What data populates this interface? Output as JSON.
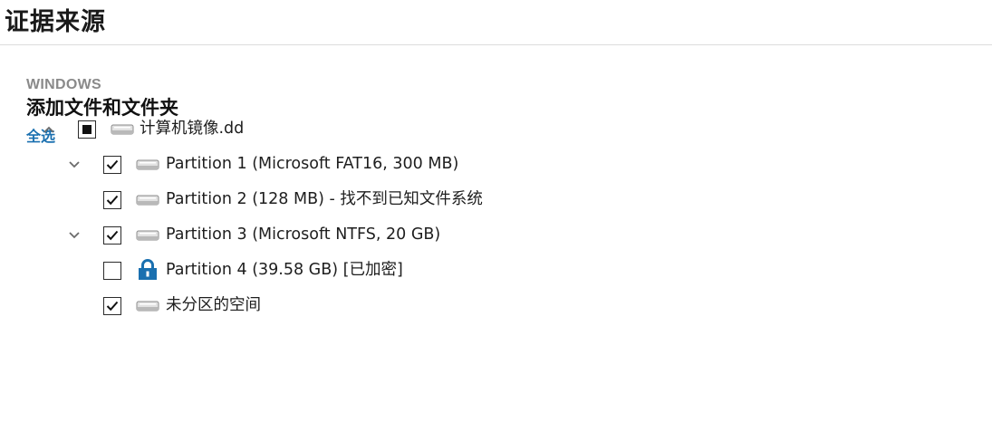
{
  "page_title": "证据来源",
  "section": {
    "os_label": "WINDOWS",
    "title": "添加文件和文件夹",
    "select_all": "全选"
  },
  "tree": {
    "root": {
      "label": "计算机镜像.dd",
      "state": "indeterminate",
      "expanded": true
    },
    "items": [
      {
        "label": "Partition 1 (Microsoft FAT16, 300 MB)",
        "checked": true,
        "expandable": true,
        "icon": "drive-icon"
      },
      {
        "label": "Partition 2 (128 MB) - 找不到已知文件系统",
        "checked": true,
        "expandable": false,
        "icon": "drive-icon"
      },
      {
        "label": "Partition 3 (Microsoft NTFS, 20 GB)",
        "checked": true,
        "expandable": true,
        "icon": "drive-icon"
      },
      {
        "label": "Partition 4 (39.58 GB) [已加密]",
        "checked": false,
        "expandable": false,
        "icon": "lock-icon"
      },
      {
        "label": "未分区的空间",
        "checked": true,
        "expandable": false,
        "icon": "drive-icon"
      }
    ]
  },
  "colors": {
    "accent": "#1a70b0",
    "lock": "#1a70b0"
  }
}
